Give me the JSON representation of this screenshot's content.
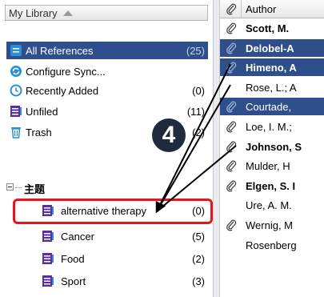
{
  "library": {
    "header": "My Library",
    "items": [
      {
        "label": "All References",
        "count": "(25)",
        "icon": "all-references-icon",
        "selected": true
      },
      {
        "label": "Configure Sync...",
        "count": "",
        "icon": "sync-icon"
      },
      {
        "label": "Recently Added",
        "count": "(0)",
        "icon": "recently-added-icon"
      },
      {
        "label": "Unfiled",
        "count": "(11)",
        "icon": "unfiled-icon"
      },
      {
        "label": "Trash",
        "count": "(2)",
        "icon": "trash-icon"
      }
    ],
    "group_label": "主题",
    "groups": [
      {
        "label": "alternative therapy",
        "count": "(0)"
      },
      {
        "label": "Cancer",
        "count": "(5)"
      },
      {
        "label": "Food",
        "count": "(2)"
      },
      {
        "label": "Sport",
        "count": "(3)"
      }
    ]
  },
  "references": {
    "author_header": "Author",
    "rows": [
      {
        "author": "Scott, M.",
        "bold": true,
        "attach": true,
        "selected": false
      },
      {
        "author": "Delobel-A",
        "bold": true,
        "attach": true,
        "selected": true
      },
      {
        "author": "Himeno, A",
        "bold": true,
        "attach": true,
        "selected": true
      },
      {
        "author": "Rose, L.; A",
        "bold": false,
        "attach": false,
        "selected": false
      },
      {
        "author": "Courtade,",
        "bold": false,
        "attach": true,
        "selected": true
      },
      {
        "author": "Loe, I. M.;",
        "bold": false,
        "attach": true,
        "selected": false
      },
      {
        "author": "Johnson, S",
        "bold": true,
        "attach": true,
        "selected": false
      },
      {
        "author": "Mulder, H",
        "bold": false,
        "attach": true,
        "selected": false
      },
      {
        "author": "Elgen, S. I",
        "bold": true,
        "attach": true,
        "selected": false
      },
      {
        "author": "Ure, A. M.",
        "bold": false,
        "attach": false,
        "selected": false
      },
      {
        "author": "Wernig, M",
        "bold": false,
        "attach": true,
        "selected": false
      },
      {
        "author": "Rosenberg",
        "bold": false,
        "attach": false,
        "selected": false
      }
    ]
  },
  "callout": {
    "number": "4"
  },
  "colors": {
    "selection": "#2e4f8c",
    "highlight": "#e8131b",
    "folder_purple": "#5b2d9e",
    "sync_blue": "#2a8fd6"
  }
}
